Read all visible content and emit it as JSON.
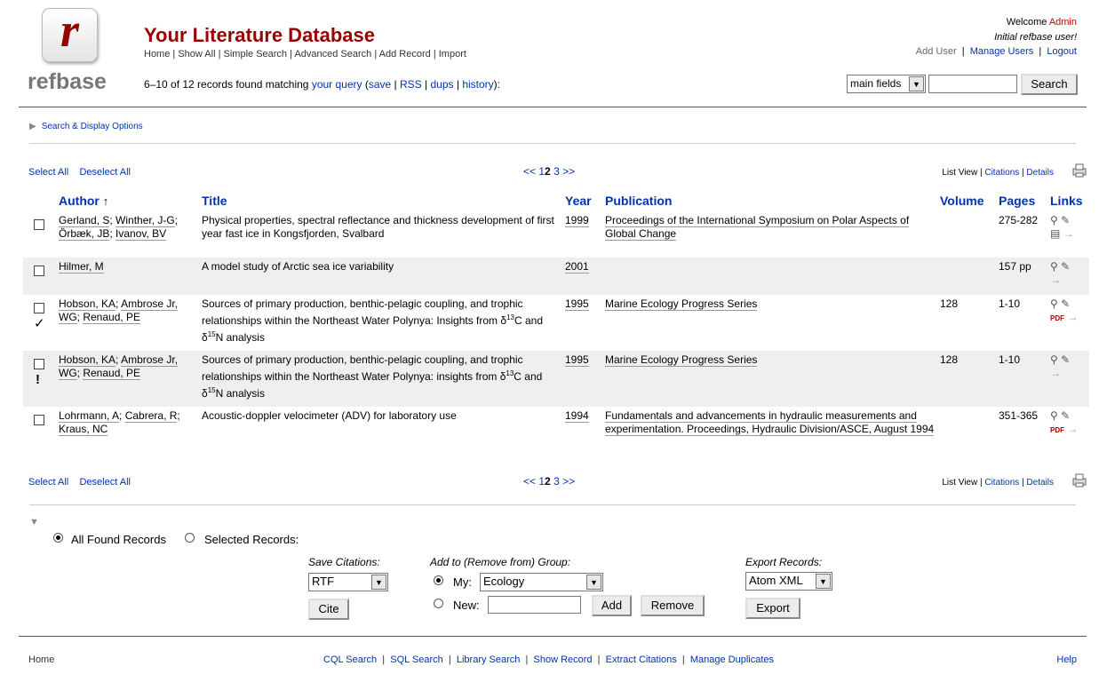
{
  "logo": {
    "letter": "r",
    "word": "refbase"
  },
  "header": {
    "title": "Your Literature Database",
    "nav": [
      "Home",
      "Show All",
      "Simple Search",
      "Advanced Search",
      "Add Record",
      "Import"
    ],
    "welcome_prefix": "Welcome",
    "welcome_user": "Admin",
    "welcome_note": "Initial refbase user!",
    "user_nav": [
      "Add User",
      "Manage Users",
      "Logout"
    ]
  },
  "results_summary": {
    "text_prefix": "6–10 of 12 records found matching",
    "query_link": "your query",
    "open_paren": "(",
    "links": [
      "save",
      "RSS",
      "dups",
      "history"
    ],
    "close": "):"
  },
  "quick_search": {
    "field_value": "main fields",
    "input_value": "",
    "button": "Search"
  },
  "options_toggle": "Search & Display Options",
  "selection": {
    "select_all": "Select All",
    "deselect_all": "Deselect All"
  },
  "pager": {
    "prev": "<<",
    "pages": [
      "1",
      "2",
      "3"
    ],
    "current": "2",
    "next": ">>"
  },
  "views": {
    "list": "List View",
    "citations": "Citations",
    "details": "Details"
  },
  "table": {
    "headers": {
      "author": "Author",
      "sort_arrow": "↑",
      "title": "Title",
      "year": "Year",
      "publication": "Publication",
      "volume": "Volume",
      "pages": "Pages",
      "links": "Links"
    },
    "rows": [
      {
        "authors": [
          "Gerland, S",
          "Winther, J-G",
          "Örbæk, JB",
          "Ivanov, BV"
        ],
        "title": "Physical properties, spectral reflectance and thickness development of first year fast ice in Kongsfjorden, Svalbard",
        "year": "1999",
        "publication": "Proceedings of the International Symposium on Polar Aspects of Global Change",
        "volume": "",
        "pages": "275-282",
        "mark": ""
      },
      {
        "authors": [
          "Hilmer, M"
        ],
        "title": "A model study of Arctic sea ice variability",
        "year": "2001",
        "publication": "",
        "volume": "",
        "pages": "157 pp",
        "mark": ""
      },
      {
        "authors": [
          "Hobson, KA",
          "Ambrose Jr, WG",
          "Renaud, PE"
        ],
        "title_a": "Sources of primary production, benthic-pelagic coupling, and trophic relationships within the Northeast Water Polynya: Insights from δ",
        "title_sup1": "13",
        "title_b": "C and δ",
        "title_sup2": "15",
        "title_c": "N analysis",
        "year": "1995",
        "publication": "Marine Ecology Progress Series",
        "volume": "128",
        "pages": "1-10",
        "mark": "✓"
      },
      {
        "authors": [
          "Hobson, KA",
          "Ambrose Jr, WG",
          "Renaud, PE"
        ],
        "title_a": "Sources of primary production, benthic-pelagic coupling, and trophic relationships within the Northeast Water Polynya: insights from δ",
        "title_sup1": "13",
        "title_b": "C and δ",
        "title_sup2": "15",
        "title_c": "N analysis",
        "year": "1995",
        "publication": "Marine Ecology Progress Series",
        "volume": "128",
        "pages": "1-10",
        "mark": "!"
      },
      {
        "authors": [
          "Lohrmann, A",
          "Cabrera, R",
          "Kraus, NC"
        ],
        "title": "Acoustic-doppler velocimeter (ADV) for laboratory use",
        "year": "1994",
        "publication": "Fundamentals and advancements in hydraulic measurements and experimentation. Proceedings, Hydraulic Division/ASCE, August 1994",
        "volume": "",
        "pages": "351-365",
        "mark": ""
      }
    ]
  },
  "actions": {
    "all_found": "All Found Records",
    "selected": "Selected Records:",
    "save_citations_label": "Save Citations:",
    "cite_format": "RTF",
    "cite_button": "Cite",
    "group_label": "Add to (Remove from) Group:",
    "my_label": "My:",
    "my_group": "Ecology",
    "new_label": "New:",
    "add_button": "Add",
    "remove_button": "Remove",
    "export_label": "Export Records:",
    "export_format": "Atom XML",
    "export_button": "Export"
  },
  "footer": {
    "home": "Home",
    "links": [
      "CQL Search",
      "SQL Search",
      "Library Search",
      "Show Record",
      "Extract Citations",
      "Manage Duplicates"
    ],
    "help": "Help"
  }
}
